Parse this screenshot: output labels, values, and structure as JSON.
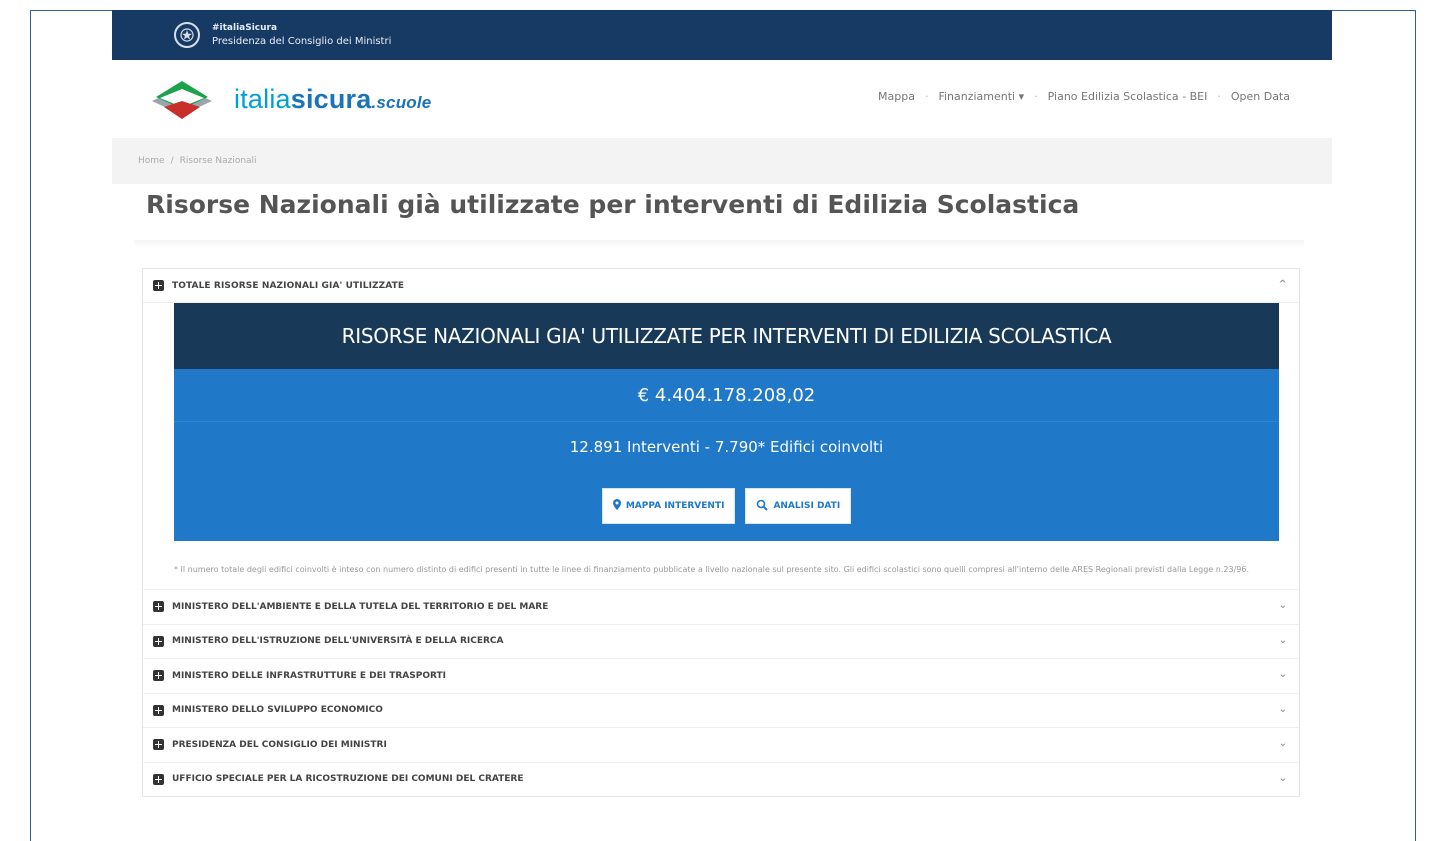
{
  "topbar": {
    "line1": "#italiaSicura",
    "line2": "Presidenza del Consiglio dei Ministri"
  },
  "logo": {
    "part1": "italia",
    "part2": "sicura",
    "part3": ".scuole",
    "colors": {
      "top": "#1aa34a",
      "middle": "#ffffff",
      "bottom": "#c9302c",
      "text": "#00a0d2"
    }
  },
  "nav": {
    "items": [
      "Mappa",
      "Finanziamenti ▾",
      "Piano Edilizia Scolastica - BEI",
      "Open Data"
    ]
  },
  "breadcrumb": {
    "home": "Home",
    "current": "Risorse Nazionali"
  },
  "page_title": "Risorse Nazionali già utilizzate per interventi di Edilizia Scolastica",
  "accordion": {
    "open_section": {
      "label": "TOTALE RISORSE NAZIONALI GIA' UTILIZZATE",
      "chevron": "^"
    },
    "panel": {
      "title": "RISORSE NAZIONALI GIA' UTILIZZATE PER INTERVENTI DI EDILIZIA SCOLASTICA",
      "amount": "€ 4.404.178.208,02",
      "counts": "12.891 Interventi - 7.790* Edifici coinvolti",
      "btn_map": "MAPPA INTERVENTI",
      "btn_analysis": "ANALISI DATI",
      "colors": {
        "dark": "#183a58",
        "blue": "#1f78c8"
      }
    },
    "footnote": "* Il numero totale degli edifici coinvolti è inteso con numero distinto di edifici presenti in tutte le linee di finanziamento pubblicate a livello nazionale sul presente sito. Gli edifici scolastici sono quelli compresi all'interno delle ARES Regionali previsti dalla Legge n.23/96.",
    "sections": [
      {
        "label": "MINISTERO DELL'AMBIENTE E DELLA TUTELA DEL TERRITORIO E DEL MARE",
        "chevron": "⌄"
      },
      {
        "label": "MINISTERO DELL'ISTRUZIONE DELL'UNIVERSITÀ E DELLA RICERCA",
        "chevron": "⌄"
      },
      {
        "label": "MINISTERO DELLE INFRASTRUTTURE E DEI TRASPORTI",
        "chevron": "⌄"
      },
      {
        "label": "MINISTERO DELLO SVILUPPO ECONOMICO",
        "chevron": "⌄"
      },
      {
        "label": "PRESIDENZA DEL CONSIGLIO DEI MINISTRI",
        "chevron": "⌄"
      },
      {
        "label": "UFFICIO SPECIALE PER LA RICOSTRUZIONE DEI COMUNI DEL CRATERE",
        "chevron": "⌄"
      }
    ]
  }
}
